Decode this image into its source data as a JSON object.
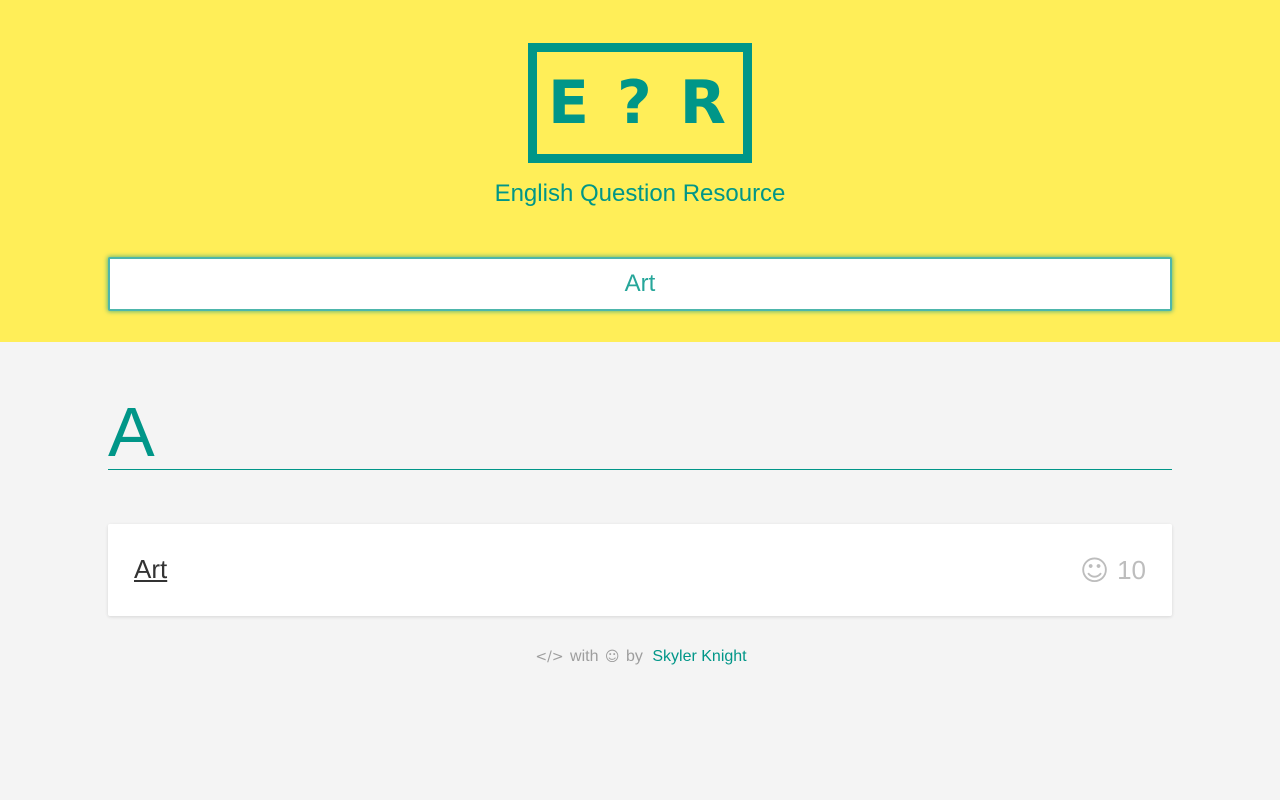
{
  "brand": {
    "logo_left": "E",
    "logo_middle": "?",
    "logo_right": "R",
    "tagline": "English Question Resource",
    "colors": {
      "header_bg": "#ffee58",
      "accent": "#009688",
      "page_bg": "#f4f4f4"
    }
  },
  "search": {
    "value": "Art"
  },
  "results": {
    "section_letter": "A",
    "items": [
      {
        "title": "Art",
        "count": "10",
        "icon": "smile-icon"
      }
    ]
  },
  "footer": {
    "code_icon": "code-icon",
    "with_text": "with",
    "smile_icon": "smile-icon",
    "by_text": "by",
    "author": "Skyler Knight"
  }
}
